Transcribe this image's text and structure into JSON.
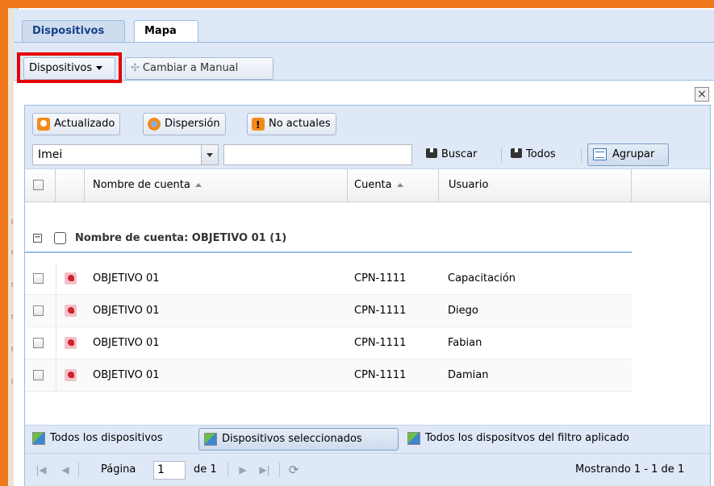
{
  "tabs": [
    {
      "label": "Dispositivos",
      "active": false
    },
    {
      "label": "Mapa",
      "active": true
    }
  ],
  "toolbar": {
    "devices_menu_label": "Dispositivos",
    "switch_manual_label": "Cambiar a Manual"
  },
  "close_label": "×",
  "filters": {
    "updated_label": "Actualizado",
    "dispersion_label": "Dispersión",
    "not_current_label": "No actuales"
  },
  "search": {
    "field_value": "Imei",
    "search_value": "",
    "search_button": "Buscar",
    "all_button": "Todos",
    "group_button": "Agrupar"
  },
  "grid": {
    "columns": [
      {
        "label": "Nombre de cuenta",
        "sorted": "asc"
      },
      {
        "label": "Cuenta",
        "sorted": "asc"
      },
      {
        "label": "Usuario"
      }
    ],
    "group_label": "Nombre de cuenta: OBJETIVO 01 (1)",
    "rows": [
      {
        "account_name": "OBJETIVO 01",
        "account": "CPN-1111",
        "user": "Capacitación"
      },
      {
        "account_name": "OBJETIVO 01",
        "account": "CPN-1111",
        "user": "Diego"
      },
      {
        "account_name": "OBJETIVO 01",
        "account": "CPN-1111",
        "user": "Fabian"
      },
      {
        "account_name": "OBJETIVO 01",
        "account": "CPN-1111",
        "user": "Damian"
      }
    ]
  },
  "scope": {
    "all_devices": "Todos los dispositivos",
    "selected_devices": "Dispositivos seleccionados",
    "filtered_devices": "Todos los dispositvos del filtro aplicado"
  },
  "pager": {
    "page_label": "Página",
    "page_value": "1",
    "of_label": "de 1",
    "status": "Mostrando 1 - 1 de 1"
  },
  "colors": {
    "accent_frame": "#f07a1b",
    "highlight_box": "#e60000",
    "toolbar_bg": "#dfe8f6"
  }
}
